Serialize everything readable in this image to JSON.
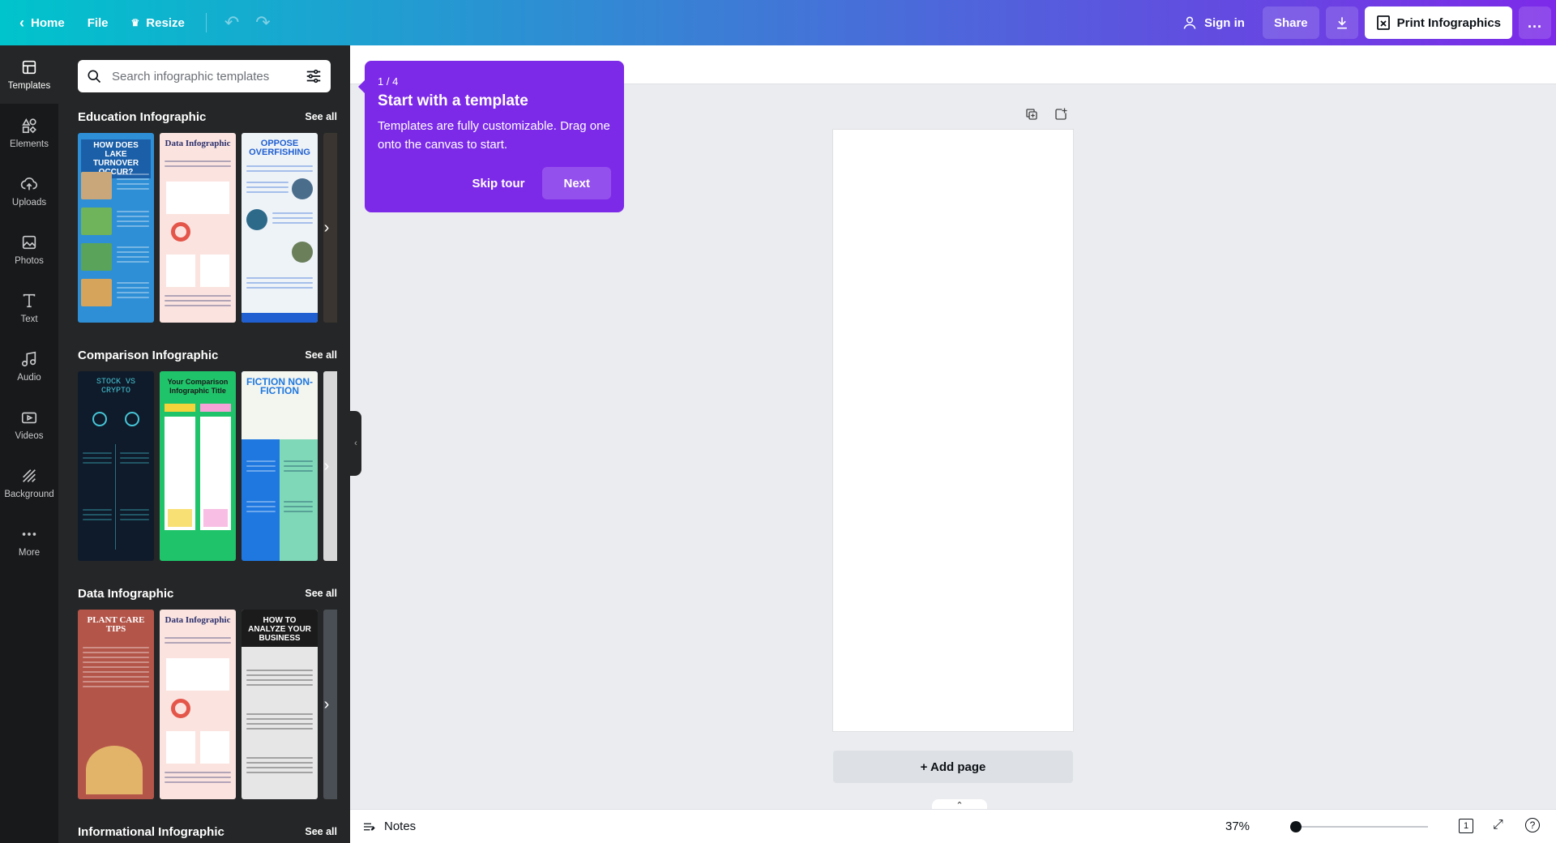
{
  "topbar": {
    "home": "Home",
    "file": "File",
    "resize": "Resize",
    "sign_in": "Sign in",
    "share": "Share",
    "print": "Print Infographics",
    "more": "..."
  },
  "rail": {
    "items": [
      {
        "label": "Templates",
        "icon": "templates-icon"
      },
      {
        "label": "Elements",
        "icon": "elements-icon"
      },
      {
        "label": "Uploads",
        "icon": "cloud-upload-icon"
      },
      {
        "label": "Photos",
        "icon": "image-icon"
      },
      {
        "label": "Text",
        "icon": "text-icon"
      },
      {
        "label": "Audio",
        "icon": "music-icon"
      },
      {
        "label": "Videos",
        "icon": "video-icon"
      },
      {
        "label": "Background",
        "icon": "background-icon"
      },
      {
        "label": "More",
        "icon": "more-dots-icon"
      }
    ]
  },
  "panel": {
    "search_placeholder": "Search infographic templates",
    "see_all": "See all",
    "sections": [
      {
        "title": "Education Infographic",
        "thumbs": [
          {
            "title": "HOW DOES LAKE TURNOVER OCCUR?",
            "bg": "#2e8fd6",
            "fg": "#ffffff"
          },
          {
            "title": "Data Infographic",
            "bg": "#fbe4e0",
            "fg": "#2b2f6b"
          },
          {
            "title": "OPPOSE OVERFISHING",
            "bg": "#eef3f8",
            "fg": "#1f5fd1"
          }
        ]
      },
      {
        "title": "Comparison Infographic",
        "thumbs": [
          {
            "title": "STOCK VS CRYPTO",
            "bg": "#0f1b2a",
            "fg": "#46c6d8"
          },
          {
            "title": "Your Comparison Infographic Title",
            "bg": "#1fc46a",
            "fg": "#1a1a1a"
          },
          {
            "title": "FICTION NON-FICTION",
            "bg": "#1e78e0",
            "fg": "#ffffff"
          }
        ]
      },
      {
        "title": "Data Infographic",
        "thumbs": [
          {
            "title": "PLANT CARE TIPS",
            "bg": "#b45549",
            "fg": "#ffffff"
          },
          {
            "title": "Data Infographic",
            "bg": "#fbe4e0",
            "fg": "#2b2f6b"
          },
          {
            "title": "HOW TO ANALYZE YOUR BUSINESS",
            "bg": "#e6e6e6",
            "fg": "#ffffff"
          }
        ]
      },
      {
        "title": "Informational Infographic",
        "thumbs": []
      }
    ]
  },
  "tour": {
    "step": "1 / 4",
    "title": "Start with a template",
    "text": "Templates are fully customizable. Drag one onto the canvas to start.",
    "skip": "Skip tour",
    "next": "Next"
  },
  "canvas": {
    "add_page": "+ Add page"
  },
  "bottombar": {
    "notes": "Notes",
    "zoom": "37%",
    "zoom_level": 0.0,
    "page_count": "1"
  },
  "colors": {
    "accent": "#7d2ae8",
    "teal": "#00c4cc",
    "panel": "#252627",
    "rail": "#18191b"
  }
}
